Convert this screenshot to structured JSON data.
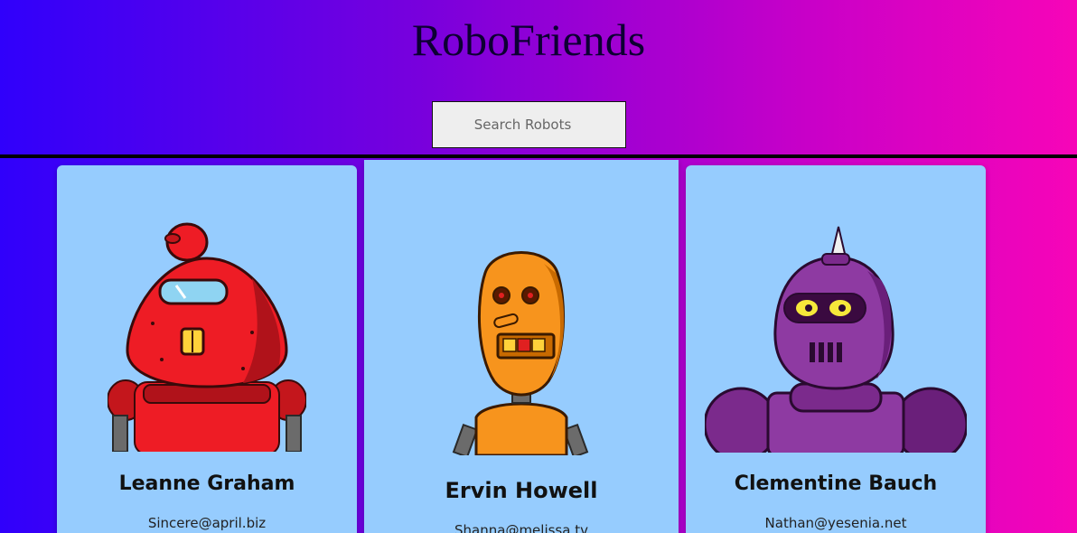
{
  "app": {
    "title": "RoboFriends"
  },
  "search": {
    "placeholder": "Search Robots"
  },
  "robots": [
    {
      "name": "Leanne Graham",
      "email": "Sincere@april.biz",
      "avatar_icon": "red-robot-icon"
    },
    {
      "name": "Ervin Howell",
      "email": "Shanna@melissa.tv",
      "avatar_icon": "orange-robot-icon"
    },
    {
      "name": "Clementine Bauch",
      "email": "Nathan@yesenia.net",
      "avatar_icon": "purple-robot-icon"
    }
  ],
  "colors": {
    "gradient_start": "#3000fb",
    "gradient_end": "#f705b8",
    "card_background": "#96ccfe",
    "divider": "#000000"
  }
}
